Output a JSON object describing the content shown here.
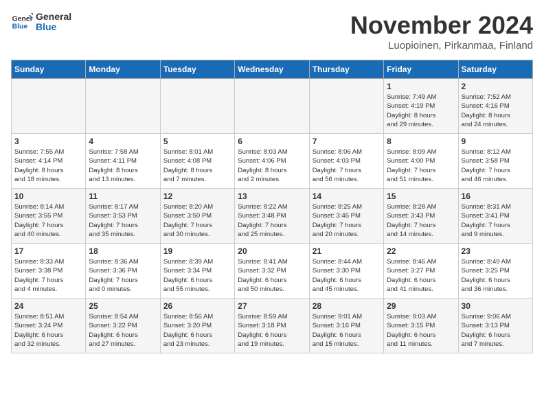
{
  "header": {
    "logo_general": "General",
    "logo_blue": "Blue",
    "title": "November 2024",
    "subtitle": "Luopioinen, Pirkanmaa, Finland"
  },
  "weekdays": [
    "Sunday",
    "Monday",
    "Tuesday",
    "Wednesday",
    "Thursday",
    "Friday",
    "Saturday"
  ],
  "weeks": [
    [
      {
        "day": "",
        "info": ""
      },
      {
        "day": "",
        "info": ""
      },
      {
        "day": "",
        "info": ""
      },
      {
        "day": "",
        "info": ""
      },
      {
        "day": "",
        "info": ""
      },
      {
        "day": "1",
        "info": "Sunrise: 7:49 AM\nSunset: 4:19 PM\nDaylight: 8 hours\nand 29 minutes."
      },
      {
        "day": "2",
        "info": "Sunrise: 7:52 AM\nSunset: 4:16 PM\nDaylight: 8 hours\nand 24 minutes."
      }
    ],
    [
      {
        "day": "3",
        "info": "Sunrise: 7:55 AM\nSunset: 4:14 PM\nDaylight: 8 hours\nand 18 minutes."
      },
      {
        "day": "4",
        "info": "Sunrise: 7:58 AM\nSunset: 4:11 PM\nDaylight: 8 hours\nand 13 minutes."
      },
      {
        "day": "5",
        "info": "Sunrise: 8:01 AM\nSunset: 4:08 PM\nDaylight: 8 hours\nand 7 minutes."
      },
      {
        "day": "6",
        "info": "Sunrise: 8:03 AM\nSunset: 4:06 PM\nDaylight: 8 hours\nand 2 minutes."
      },
      {
        "day": "7",
        "info": "Sunrise: 8:06 AM\nSunset: 4:03 PM\nDaylight: 7 hours\nand 56 minutes."
      },
      {
        "day": "8",
        "info": "Sunrise: 8:09 AM\nSunset: 4:00 PM\nDaylight: 7 hours\nand 51 minutes."
      },
      {
        "day": "9",
        "info": "Sunrise: 8:12 AM\nSunset: 3:58 PM\nDaylight: 7 hours\nand 46 minutes."
      }
    ],
    [
      {
        "day": "10",
        "info": "Sunrise: 8:14 AM\nSunset: 3:55 PM\nDaylight: 7 hours\nand 40 minutes."
      },
      {
        "day": "11",
        "info": "Sunrise: 8:17 AM\nSunset: 3:53 PM\nDaylight: 7 hours\nand 35 minutes."
      },
      {
        "day": "12",
        "info": "Sunrise: 8:20 AM\nSunset: 3:50 PM\nDaylight: 7 hours\nand 30 minutes."
      },
      {
        "day": "13",
        "info": "Sunrise: 8:22 AM\nSunset: 3:48 PM\nDaylight: 7 hours\nand 25 minutes."
      },
      {
        "day": "14",
        "info": "Sunrise: 8:25 AM\nSunset: 3:45 PM\nDaylight: 7 hours\nand 20 minutes."
      },
      {
        "day": "15",
        "info": "Sunrise: 8:28 AM\nSunset: 3:43 PM\nDaylight: 7 hours\nand 14 minutes."
      },
      {
        "day": "16",
        "info": "Sunrise: 8:31 AM\nSunset: 3:41 PM\nDaylight: 7 hours\nand 9 minutes."
      }
    ],
    [
      {
        "day": "17",
        "info": "Sunrise: 8:33 AM\nSunset: 3:38 PM\nDaylight: 7 hours\nand 4 minutes."
      },
      {
        "day": "18",
        "info": "Sunrise: 8:36 AM\nSunset: 3:36 PM\nDaylight: 7 hours\nand 0 minutes."
      },
      {
        "day": "19",
        "info": "Sunrise: 8:39 AM\nSunset: 3:34 PM\nDaylight: 6 hours\nand 55 minutes."
      },
      {
        "day": "20",
        "info": "Sunrise: 8:41 AM\nSunset: 3:32 PM\nDaylight: 6 hours\nand 50 minutes."
      },
      {
        "day": "21",
        "info": "Sunrise: 8:44 AM\nSunset: 3:30 PM\nDaylight: 6 hours\nand 45 minutes."
      },
      {
        "day": "22",
        "info": "Sunrise: 8:46 AM\nSunset: 3:27 PM\nDaylight: 6 hours\nand 41 minutes."
      },
      {
        "day": "23",
        "info": "Sunrise: 8:49 AM\nSunset: 3:25 PM\nDaylight: 6 hours\nand 36 minutes."
      }
    ],
    [
      {
        "day": "24",
        "info": "Sunrise: 8:51 AM\nSunset: 3:24 PM\nDaylight: 6 hours\nand 32 minutes."
      },
      {
        "day": "25",
        "info": "Sunrise: 8:54 AM\nSunset: 3:22 PM\nDaylight: 6 hours\nand 27 minutes."
      },
      {
        "day": "26",
        "info": "Sunrise: 8:56 AM\nSunset: 3:20 PM\nDaylight: 6 hours\nand 23 minutes."
      },
      {
        "day": "27",
        "info": "Sunrise: 8:59 AM\nSunset: 3:18 PM\nDaylight: 6 hours\nand 19 minutes."
      },
      {
        "day": "28",
        "info": "Sunrise: 9:01 AM\nSunset: 3:16 PM\nDaylight: 6 hours\nand 15 minutes."
      },
      {
        "day": "29",
        "info": "Sunrise: 9:03 AM\nSunset: 3:15 PM\nDaylight: 6 hours\nand 11 minutes."
      },
      {
        "day": "30",
        "info": "Sunrise: 9:06 AM\nSunset: 3:13 PM\nDaylight: 6 hours\nand 7 minutes."
      }
    ]
  ]
}
